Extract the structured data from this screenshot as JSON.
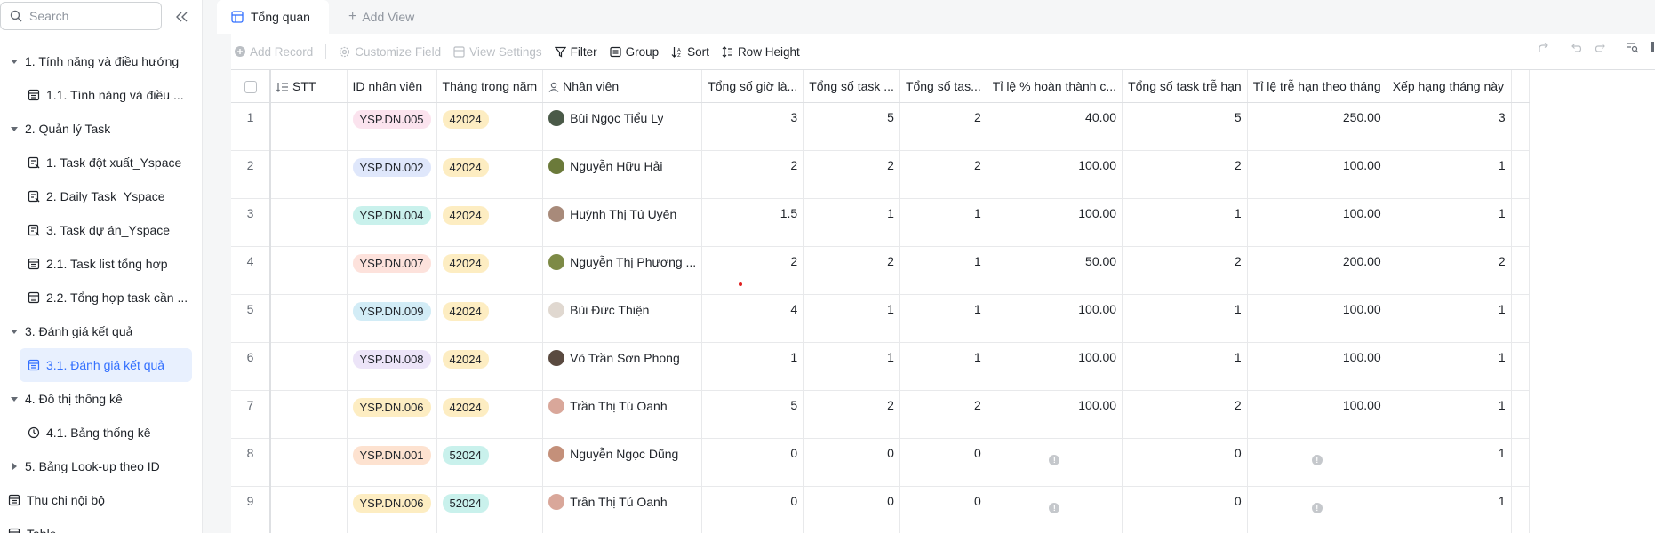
{
  "sidebar": {
    "search_placeholder": "Search",
    "items": [
      {
        "label": "1. Tính năng và điều hướng",
        "level": 0,
        "type": "folder"
      },
      {
        "label": "1.1. Tính năng và điều ...",
        "level": 1,
        "type": "table"
      },
      {
        "label": "2. Quản lý Task",
        "level": 0,
        "type": "folder"
      },
      {
        "label": "1. Task đột xuất_Yspace",
        "level": 1,
        "type": "form"
      },
      {
        "label": "2. Daily Task_Yspace",
        "level": 1,
        "type": "form"
      },
      {
        "label": "3. Task dự án_Yspace",
        "level": 1,
        "type": "form"
      },
      {
        "label": "2.1. Task list tổng hợp",
        "level": 1,
        "type": "table"
      },
      {
        "label": "2.2. Tổng hợp task cần ...",
        "level": 1,
        "type": "table"
      },
      {
        "label": "3. Đánh giá kết quả",
        "level": 0,
        "type": "folder"
      },
      {
        "label": "3.1. Đánh giá kết quả",
        "level": 1,
        "type": "table",
        "active": true
      },
      {
        "label": "4. Đồ thị thống kê",
        "level": 0,
        "type": "folder"
      },
      {
        "label": "4.1. Bảng thống kê",
        "level": 1,
        "type": "dashboard"
      },
      {
        "label": "5. Bảng Look-up theo ID",
        "level": 0,
        "type": "folder-collapsed"
      },
      {
        "label": "Thu chi nội bộ",
        "level": 0,
        "type": "table-root"
      },
      {
        "label": "Table",
        "level": 0,
        "type": "table-root"
      }
    ]
  },
  "tabs": {
    "active_label": "Tổng quan",
    "add_view_label": "Add View"
  },
  "toolbar": {
    "add_record": "Add Record",
    "customize_field": "Customize Field",
    "view_settings": "View Settings",
    "filter": "Filter",
    "group": "Group",
    "sort": "Sort",
    "row_height": "Row Height"
  },
  "table": {
    "headers": {
      "stt": "STT",
      "id": "ID nhân viên",
      "month": "Tháng trong năm",
      "employee": "Nhân viên",
      "hours": "Tổng số giờ là...",
      "tasks": "Tổng số task ...",
      "tasks_done": "Tổng số tas...",
      "pct_done": "Tỉ lệ % hoàn thành c...",
      "late": "Tổng số task trễ hạn",
      "late_rate": "Tỉ lệ trễ hạn theo tháng",
      "rank": "Xếp hạng tháng này"
    },
    "rows": [
      {
        "n": "1",
        "id": "YSP.DN.005",
        "id_color": "#fbe3ee",
        "month": "42024",
        "month_color": "#fdedc2",
        "name": "Bùi Ngọc Tiểu Ly",
        "avatar": "#4a5a48",
        "hours": "3",
        "tasks": "5",
        "done": "2",
        "pct": "40.00",
        "late": "5",
        "rate": "250.00",
        "rank": "3"
      },
      {
        "n": "2",
        "id": "YSP.DN.002",
        "id_color": "#dfe7fb",
        "month": "42024",
        "month_color": "#fdedc2",
        "name": "Nguyễn Hữu Hải",
        "avatar": "#6b7a3a",
        "hours": "2",
        "tasks": "2",
        "done": "2",
        "pct": "100.00",
        "late": "2",
        "rate": "100.00",
        "rank": "1"
      },
      {
        "n": "3",
        "id": "YSP.DN.004",
        "id_color": "#c9f1ec",
        "month": "42024",
        "month_color": "#fdedc2",
        "name": "Huỳnh Thị Tú Uyên",
        "avatar": "#a88a7a",
        "hours": "1.5",
        "tasks": "1",
        "done": "1",
        "pct": "100.00",
        "late": "1",
        "rate": "100.00",
        "rank": "1"
      },
      {
        "n": "4",
        "id": "YSP.DN.007",
        "id_color": "#fde2dc",
        "month": "42024",
        "month_color": "#fdedc2",
        "name": "Nguyễn Thị Phương ...",
        "avatar": "#7d8a46",
        "hours": "2",
        "tasks": "2",
        "done": "1",
        "pct": "50.00",
        "late": "2",
        "rate": "200.00",
        "rank": "2"
      },
      {
        "n": "5",
        "id": "YSP.DN.009",
        "id_color": "#d2ecf6",
        "month": "42024",
        "month_color": "#fdedc2",
        "name": "Bùi Đức Thiện",
        "avatar": "#e0d8d0",
        "hours": "4",
        "tasks": "1",
        "done": "1",
        "pct": "100.00",
        "late": "1",
        "rate": "100.00",
        "rank": "1"
      },
      {
        "n": "6",
        "id": "YSP.DN.008",
        "id_color": "#ece4f8",
        "month": "42024",
        "month_color": "#fdedc2",
        "name": "Võ Trần Sơn Phong",
        "avatar": "#5a4a40",
        "hours": "1",
        "tasks": "1",
        "done": "1",
        "pct": "100.00",
        "late": "1",
        "rate": "100.00",
        "rank": "1"
      },
      {
        "n": "7",
        "id": "YSP.DN.006",
        "id_color": "#fdedc2",
        "month": "42024",
        "month_color": "#fdedc2",
        "name": "Trần Thị Tú Oanh",
        "avatar": "#d9a79a",
        "hours": "5",
        "tasks": "2",
        "done": "2",
        "pct": "100.00",
        "late": "2",
        "rate": "100.00",
        "rank": "1"
      },
      {
        "n": "8",
        "id": "YSP.DN.001",
        "id_color": "#fde2d0",
        "month": "52024",
        "month_color": "#c9f1ec",
        "name": "Nguyễn Ngọc Dũng",
        "avatar": "#c4907a",
        "hours": "0",
        "tasks": "0",
        "done": "0",
        "pct": "",
        "late": "0",
        "rate": "",
        "rank": "1"
      },
      {
        "n": "9",
        "id": "YSP.DN.006",
        "id_color": "#fdedc2",
        "month": "52024",
        "month_color": "#c9f1ec",
        "name": "Trần Thị Tú Oanh",
        "avatar": "#d9a79a",
        "hours": "0",
        "tasks": "0",
        "done": "0",
        "pct": "",
        "late": "0",
        "rate": "",
        "rank": "1"
      }
    ]
  },
  "colors": {
    "accent": "#3370ff",
    "active_bg": "#e8f0fe"
  }
}
